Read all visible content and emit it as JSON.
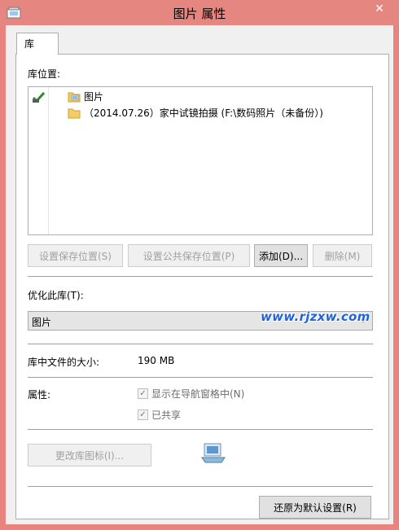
{
  "window": {
    "title": "图片 属性",
    "close_glyph": "✕"
  },
  "tabs": [
    {
      "label": "库"
    }
  ],
  "library": {
    "locations_label": "库位置:",
    "locations": [
      {
        "label": "图片",
        "icon": "library-folder-icon"
      },
      {
        "label": "（2014.07.26）家中试镜拍摄 (F:\\数码照片（未备份）)",
        "icon": "folder-icon"
      }
    ],
    "default_save_icon": "green-check-default-icon"
  },
  "buttons": {
    "set_save_location": "设置保存位置(S)",
    "set_public_save_location": "设置公共保存位置(P)",
    "add": "添加(D)...",
    "remove": "删除(M)",
    "change_icon": "更改库图标(I)...",
    "restore_defaults": "还原为默认设置(R)"
  },
  "optimize": {
    "label": "优化此库(T):",
    "selected": "图片"
  },
  "size": {
    "label": "库中文件的大小:",
    "value": "190 MB"
  },
  "attributes": {
    "label": "属性:",
    "show_in_nav": {
      "label": "显示在导航窗格中(N)",
      "checked": true
    },
    "shared": {
      "label": "已共享",
      "checked": true
    }
  },
  "watermark": "www.rjzxw.com",
  "colors": {
    "titlebar": "#e58681",
    "accent": "#1d64d8"
  }
}
